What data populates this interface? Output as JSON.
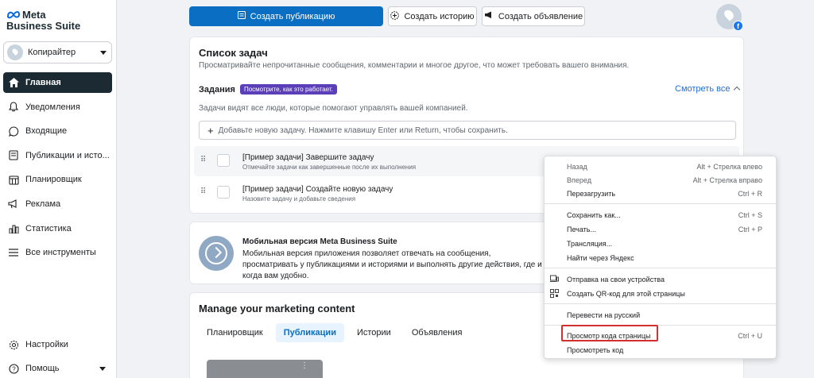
{
  "sidebar": {
    "logo": {
      "line1": "Meta",
      "line2": "Business Suite"
    },
    "account": {
      "name": "Копирайтер"
    },
    "nav": [
      {
        "label": "Главная",
        "icon": "home-icon",
        "active": true
      },
      {
        "label": "Уведомления",
        "icon": "bell-icon"
      },
      {
        "label": "Входящие",
        "icon": "chat-bubble-icon"
      },
      {
        "label": "Публикации и исто...",
        "icon": "posts-icon"
      },
      {
        "label": "Планировщик",
        "icon": "calendar-icon"
      },
      {
        "label": "Реклама",
        "icon": "megaphone-icon"
      },
      {
        "label": "Статистика",
        "icon": "bar-chart-icon"
      },
      {
        "label": "Все инструменты",
        "icon": "menu-icon"
      }
    ],
    "bottom": [
      {
        "label": "Настройки",
        "icon": "gear-icon"
      },
      {
        "label": "Помощь",
        "icon": "help-icon"
      }
    ]
  },
  "topbar": {
    "create_post": "Создать публикацию",
    "create_story": "Создать историю",
    "create_ad": "Создать объявление"
  },
  "tasks": {
    "title": "Список задач",
    "description": "Просматривайте непрочитанные сообщения, комментарии и многое другое, что может требовать вашего внимания.",
    "subtitle": "Задания",
    "badge": "Посмотрите, как это работает.",
    "see_all": "Смотреть все",
    "note": "Задачи видят все люди, которые помогают управлять вашей компанией.",
    "add_placeholder": "Добавьте новую задачу. Нажмите клавишу Enter или Return, чтобы сохранить.",
    "items": [
      {
        "title": "[Пример задачи] Завершите задачу",
        "subtitle": "Отмечайте задачи как завершенные после их выполнения"
      },
      {
        "title": "[Пример задачи] Создайте новую задачу",
        "subtitle": "Назовите задачу и добавьте сведения"
      }
    ]
  },
  "mobile": {
    "title": "Мобильная версия Meta Business Suite",
    "description": "Мобильная версия приложения позволяет отвечать на сообщения, просматривать у публикациями и историями и выполнять другие действия, где и когда вам удобно."
  },
  "manage": {
    "title": "Manage your marketing content",
    "tabs": [
      {
        "label": "Планировщик",
        "active": false
      },
      {
        "label": "Публикации",
        "active": true
      },
      {
        "label": "Истории",
        "active": false
      },
      {
        "label": "Объявления",
        "active": false
      }
    ]
  },
  "context_menu": {
    "items": [
      {
        "label": "Назад",
        "shortcut": "Alt + Стрелка влево",
        "disabled": true
      },
      {
        "label": "Вперед",
        "shortcut": "Alt + Стрелка вправо",
        "disabled": true
      },
      {
        "label": "Перезагрузить",
        "shortcut": "Ctrl + R"
      },
      {
        "label": "Сохранить как...",
        "shortcut": "Ctrl + S"
      },
      {
        "label": "Печать...",
        "shortcut": "Ctrl + P"
      },
      {
        "label": "Трансляция...",
        "shortcut": ""
      },
      {
        "label": "Найти через Яндекс",
        "shortcut": ""
      },
      {
        "label": "Отправка на свои устройства",
        "shortcut": "",
        "icon": "devices-icon"
      },
      {
        "label": "Создать QR-код для этой страницы",
        "shortcut": "",
        "icon": "qr-code-icon"
      },
      {
        "label": "Перевести на русский",
        "shortcut": ""
      },
      {
        "label": "Просмотр кода страницы",
        "shortcut": "Ctrl + U",
        "highlighted": true
      },
      {
        "label": "Просмотреть код",
        "shortcut": ""
      }
    ],
    "highlight_color": "#d32f2f"
  },
  "colors": {
    "primary": "#0a6fc2",
    "sidebar_active": "#1c2b33",
    "badge": "#5b3fb8",
    "link": "#216fdb"
  }
}
